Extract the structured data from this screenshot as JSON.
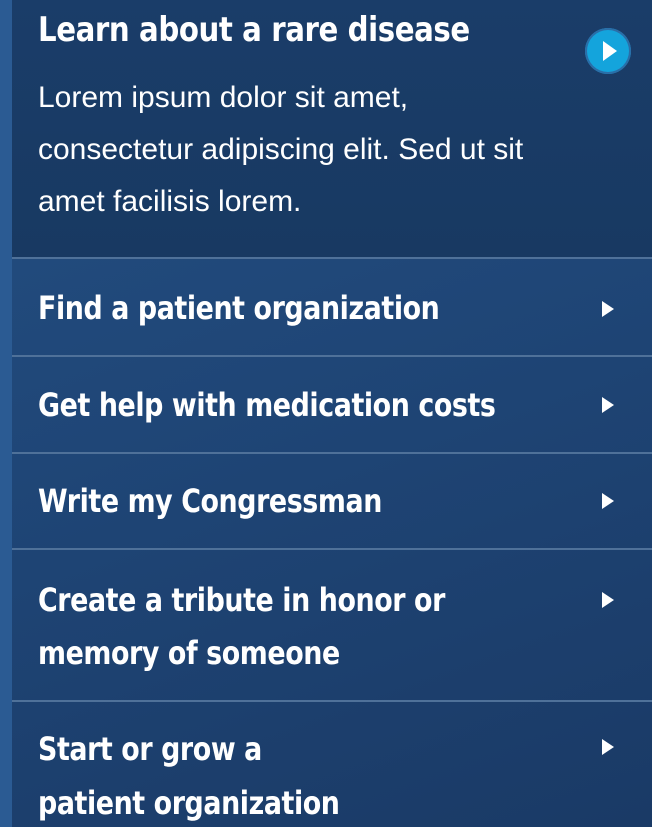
{
  "featured": {
    "title": "Learn about a rare disease",
    "text": "Lorem ipsum dolor sit amet, consectetur adipiscing elit. Sed ut sit amet facilisis lorem.",
    "icon": "play-circle-icon",
    "icon_color": "#14a4dc"
  },
  "items": [
    {
      "line1": "Find a patient organization",
      "line2": "",
      "icon": "chevron-right-icon"
    },
    {
      "line1": "Get help with medication costs",
      "line2": "",
      "icon": "chevron-right-icon"
    },
    {
      "line1": "Write my Congressman",
      "line2": "",
      "icon": "chevron-right-icon"
    },
    {
      "line1": "Create a tribute in honor or",
      "line2": "memory of someone",
      "icon": "chevron-right-icon"
    },
    {
      "line1": "Start or grow a",
      "line2": "patient organization",
      "icon": "chevron-right-icon"
    }
  ],
  "colors": {
    "background": "#1f4677",
    "featured_background": "#1a3d69",
    "divider": "#4f7199",
    "text": "#ffffff"
  }
}
